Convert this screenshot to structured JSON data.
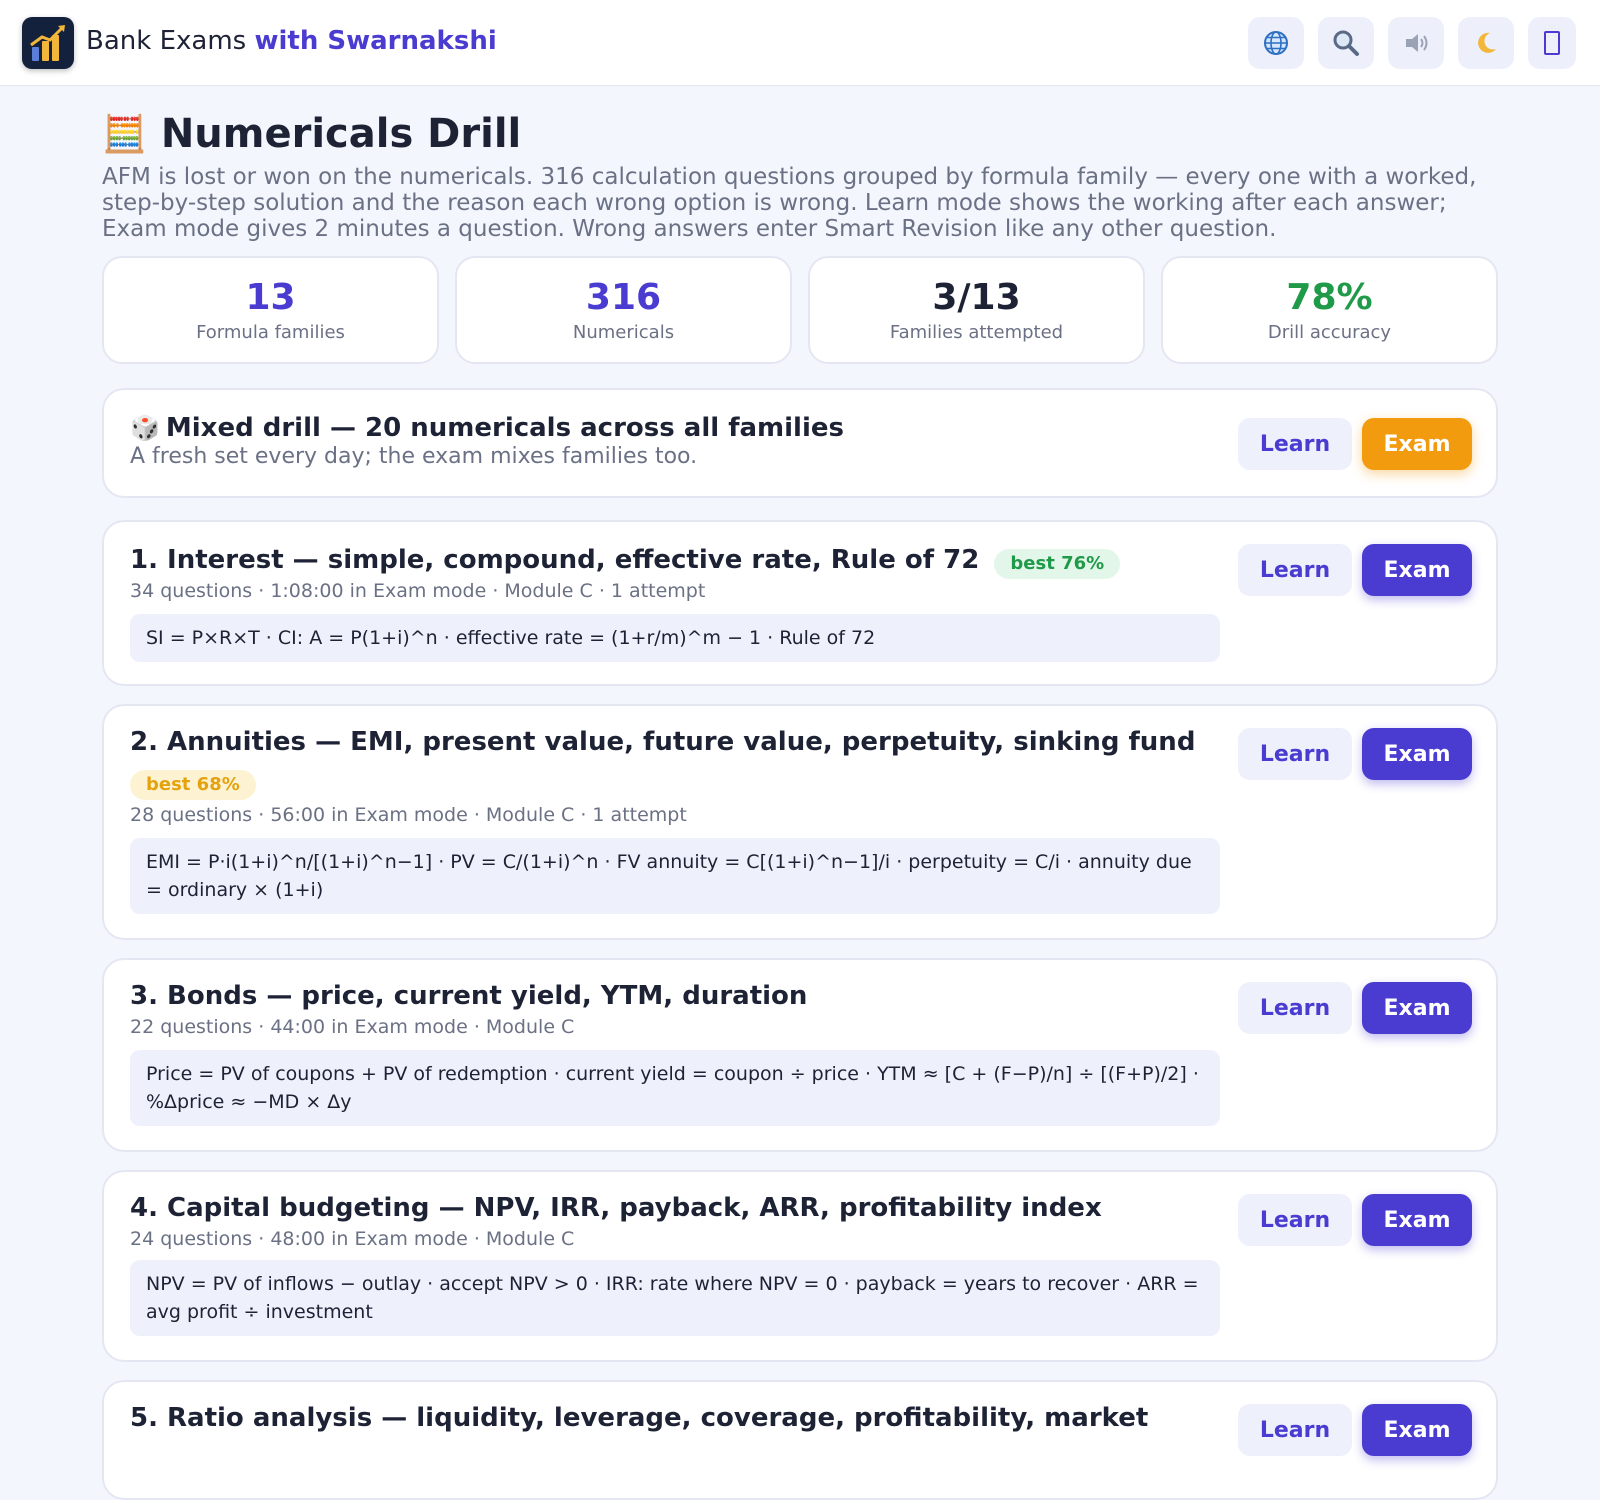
{
  "header": {
    "brand_plain": "Bank Exams ",
    "brand_accent": "with Swarnakshi",
    "icons": [
      "globe-icon",
      "search-icon",
      "speaker-icon",
      "moon-icon",
      "menu-icon"
    ]
  },
  "page": {
    "title_emoji": "🧮",
    "title": "Numericals Drill",
    "intro": "AFM is lost or won on the numericals. 316 calculation questions grouped by formula family — every one with a worked, step-by-step solution and the reason each wrong option is wrong. Learn mode shows the working after each answer; Exam mode gives 2 minutes a question. Wrong answers enter Smart Revision like any other question."
  },
  "stats": [
    {
      "value": "13",
      "label": "Formula families",
      "color": "#4a3bd1"
    },
    {
      "value": "316",
      "label": "Numericals",
      "color": "#4a3bd1"
    },
    {
      "value": "3/13",
      "label": "Families attempted",
      "color": "#1d2235"
    },
    {
      "value": "78%",
      "label": "Drill accuracy",
      "color": "#1f9a48"
    }
  ],
  "mixed": {
    "emoji": "🎲",
    "title": "Mixed drill — 20 numericals across all families",
    "subtitle": "A fresh set every day; the exam mixes families too.",
    "learn_label": "Learn",
    "exam_label": "Exam"
  },
  "families": [
    {
      "title": "1. Interest — simple, compound, effective rate, Rule of 72",
      "badge": "best 76%",
      "meta": "34 questions · 1:08:00 in Exam mode · Module C · 1 attempt",
      "formula": "SI = P×R×T · CI: A = P(1+i)^n · effective rate = (1+r/m)^m − 1 · Rule of 72",
      "learn_label": "Learn",
      "exam_label": "Exam"
    },
    {
      "title": "2. Annuities — EMI, present value, future value, perpetuity, sinking fund",
      "badge": "best 68%",
      "meta": "28 questions · 56:00 in Exam mode · Module C · 1 attempt",
      "formula": "EMI = P·i(1+i)^n/[(1+i)^n−1] · PV = C/(1+i)^n · FV annuity = C[(1+i)^n−1]/i · perpetuity = C/i · annuity due = ordinary × (1+i)",
      "learn_label": "Learn",
      "exam_label": "Exam"
    },
    {
      "title": "3. Bonds — price, current yield, YTM, duration",
      "meta": "22 questions · 44:00 in Exam mode · Module C",
      "formula": "Price = PV of coupons + PV of redemption · current yield = coupon ÷ price · YTM ≈ [C + (F−P)/n] ÷ [(F+P)/2] · %Δprice ≈ −MD × Δy",
      "learn_label": "Learn",
      "exam_label": "Exam"
    },
    {
      "title": "4. Capital budgeting — NPV, IRR, payback, ARR, profitability index",
      "meta": "24 questions · 48:00 in Exam mode · Module C",
      "formula": "NPV = PV of inflows − outlay · accept NPV > 0 · IRR: rate where NPV = 0 · payback = years to recover · ARR = avg profit ÷ investment",
      "learn_label": "Learn",
      "exam_label": "Exam"
    },
    {
      "title": "5. Ratio analysis — liquidity, leverage, coverage, profitability, market",
      "learn_label": "Learn",
      "exam_label": "Exam"
    }
  ]
}
